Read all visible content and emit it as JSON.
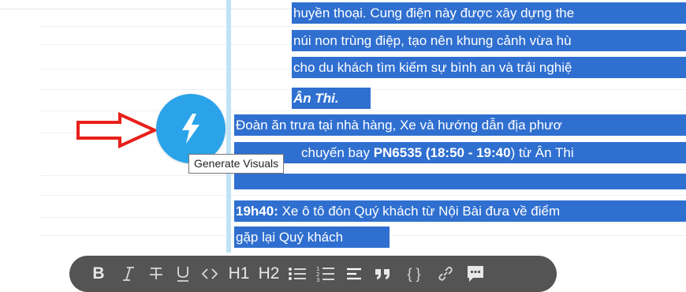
{
  "document": {
    "paragraphs": [
      {
        "text": "huyền thoại. Cung điện này được xây dựng the"
      },
      {
        "text": "núi non trùng điệp, tạo nên khung cảnh vừa hù"
      },
      {
        "text": "cho du khách tìm kiếm sự bình an và trải nghiệ"
      },
      {
        "text_bold_italic": "Ân Thi."
      },
      {
        "text": "Đoàn ăn trưa tại nhà hàng, Xe và hướng dẫn địa phươ"
      },
      {
        "pre": "chuyến bay ",
        "flight_bold": "PN6535 (18:50 - 19:40",
        "post": ") từ Ân Thi "
      },
      {
        "time_bold": "19h40:",
        "text": " Xe ô tô đón Quý khách từ Nội Bài đưa về điểm"
      },
      {
        "text": "gặp lại Quý khách"
      }
    ]
  },
  "generate_button": {
    "icon": "lightning-icon",
    "tooltip": "Generate Visuals",
    "color": "#2aa3e9"
  },
  "annotation": {
    "arrow_icon": "red-outline-arrow-right",
    "color": "#e8201a"
  },
  "toolbar": {
    "bold": "B",
    "italic": "italic-icon",
    "strikethrough": "strikethrough-icon",
    "underline": "underline-icon",
    "code": "code-icon",
    "h1": "H1",
    "h2": "H2",
    "bullet_list": "bullet-list-icon",
    "numbered_list": "numbered-list-icon",
    "align": "align-icon",
    "quote": "quote-icon",
    "code_block": "{ }",
    "link": "link-icon",
    "comment": "comment-icon"
  },
  "colors": {
    "selection": "#2f6fd0",
    "toolbar_bg": "#545454",
    "guide_bar": "#bfe3f6"
  }
}
